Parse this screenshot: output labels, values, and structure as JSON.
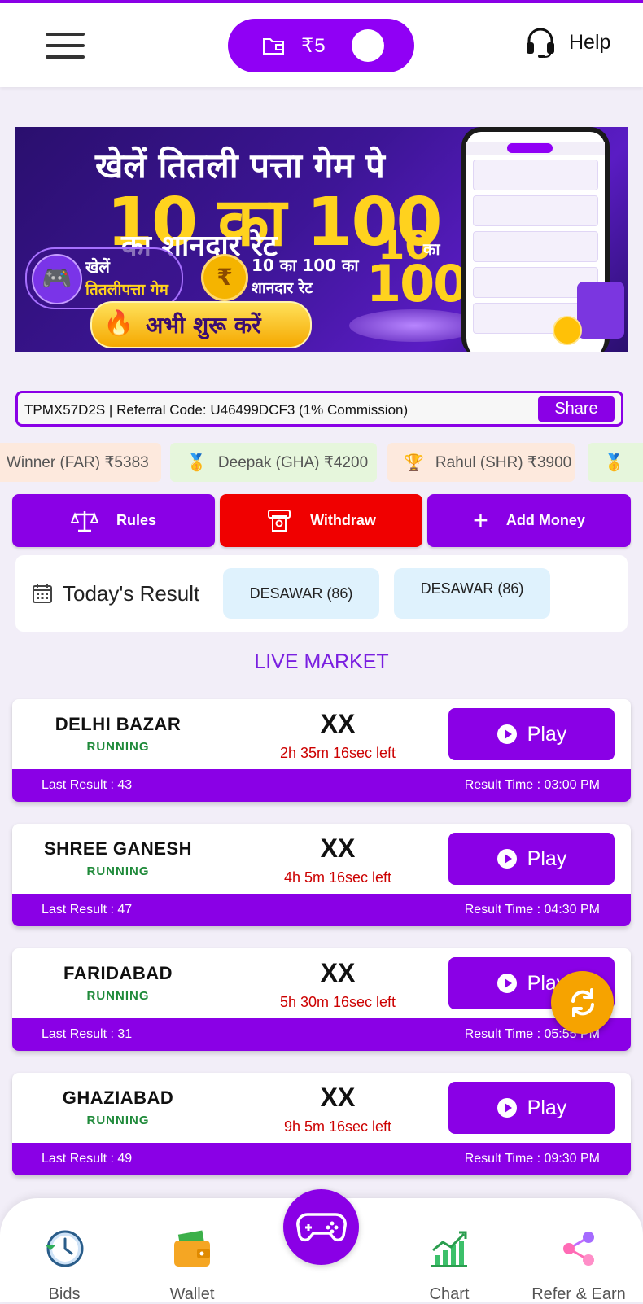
{
  "header": {
    "wallet_amount": "₹5",
    "help_label": "Help"
  },
  "banner": {
    "line1": "खेलें तितली पत्ता गेम पे",
    "line2": "10 का 100",
    "line3": "का शानदार रेट",
    "feature1_line1": "खेलें",
    "feature1_line2": "तितलीपत्ता गेम",
    "feature2_line1": "10 का 100 का",
    "feature2_line2": "शानदार रेट",
    "cta": "अभी शुरू करें",
    "badge_10": "10",
    "badge_ka": "का",
    "badge_100": "100"
  },
  "referral": {
    "text": "TPMX57D2S | Referral Code: U46499DCF3 (1% Commission)",
    "share_label": "Share"
  },
  "ticker": [
    {
      "text": "Winner (FAR)  ₹5383",
      "color": "#fde9dd"
    },
    {
      "icon": "🥇",
      "text": "Deepak (GHA)  ₹4200",
      "color": "#e6f6dc"
    },
    {
      "icon": "🏆",
      "text": "Rahul (SHR)  ₹3900",
      "color": "#fde9dd"
    },
    {
      "icon": "🥇",
      "text": "",
      "color": "#e6f6dc"
    }
  ],
  "actions": {
    "rules": "Rules",
    "withdraw": "Withdraw",
    "add_money": "Add Money"
  },
  "today": {
    "label": "Today's Result",
    "results": [
      "DESAWAR (86)",
      "DESAWAR (86)"
    ]
  },
  "live_market_title": "LIVE MARKET",
  "markets": [
    {
      "name": "DELHI BAZAR",
      "status": "RUNNING",
      "number": "XX",
      "timer": "2h 35m 16sec left",
      "play": "Play",
      "last_result": "Last Result : 43",
      "result_time": "Result Time : 03:00 PM"
    },
    {
      "name": "SHREE GANESH",
      "status": "RUNNING",
      "number": "XX",
      "timer": "4h 5m 16sec left",
      "play": "Play",
      "last_result": "Last Result : 47",
      "result_time": "Result Time : 04:30 PM"
    },
    {
      "name": "FARIDABAD",
      "status": "RUNNING",
      "number": "XX",
      "timer": "5h 30m 16sec left",
      "play": "Play",
      "last_result": "Last Result : 31",
      "result_time": "Result Time : 05:55 PM"
    },
    {
      "name": "GHAZIABAD",
      "status": "RUNNING",
      "number": "XX",
      "timer": "9h 5m 16sec left",
      "play": "Play",
      "last_result": "Last Result : 49",
      "result_time": "Result Time : 09:30 PM"
    }
  ],
  "nav": {
    "bids": "Bids",
    "wallet": "Wallet",
    "chart": "Chart",
    "refer": "Refer & Earn"
  },
  "colors": {
    "primary": "#8a00e6",
    "withdraw": "#f00000",
    "running": "#1f8a3a",
    "timer": "#cc0000",
    "refresh": "#f6a300"
  }
}
